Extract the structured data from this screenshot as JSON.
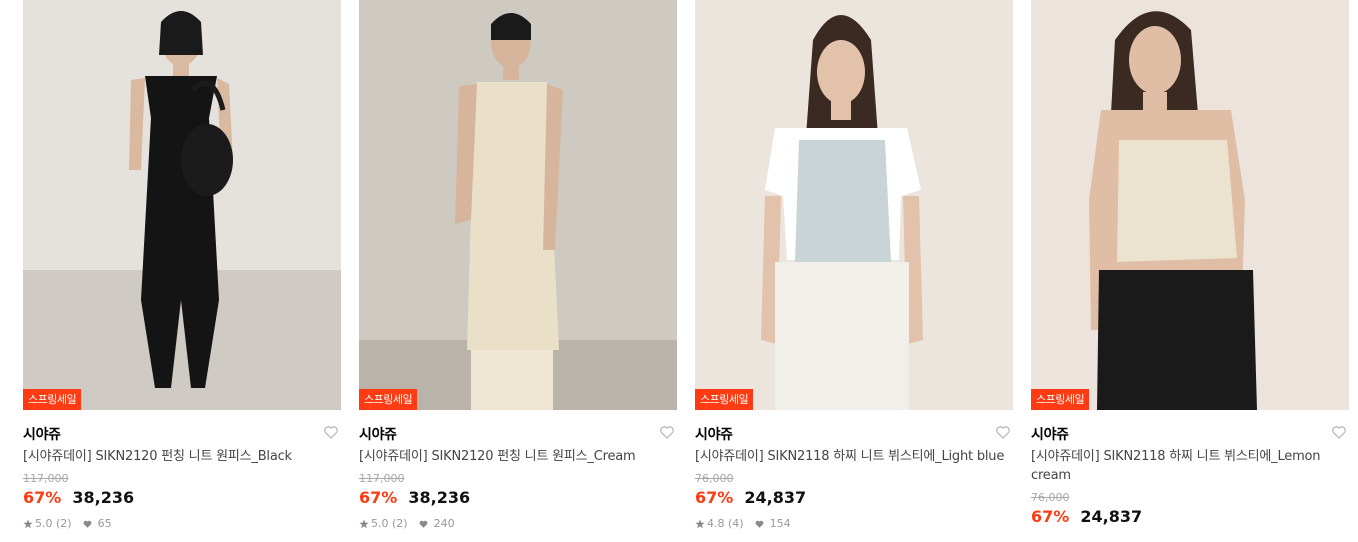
{
  "products": [
    {
      "badge": "스프링세일",
      "brand": "시야쥬",
      "title": "[시야쥬데이] SIKN2120 펀칭 니트 원피스_Black",
      "original_price": "117,000",
      "discount": "67%",
      "price": "38,236",
      "rating": "5.0 (2)",
      "likes": "65",
      "colors": {
        "bg": "#e5e2dd",
        "floor": "#cfcac3",
        "garment": "#141414",
        "pants": "#1b1b1b",
        "skin": "#d9b9a0"
      }
    },
    {
      "badge": "스프링세일",
      "brand": "시야쥬",
      "title": "[시야쥬데이] SIKN2120 펀칭 니트 원피스_Cream",
      "original_price": "117,000",
      "discount": "67%",
      "price": "38,236",
      "rating": "5.0 (2)",
      "likes": "240",
      "colors": {
        "bg": "#cfcac1",
        "floor": "#b9b3aa",
        "garment": "#eadfc7",
        "pants": "#efe6d3",
        "skin": "#d7b59c"
      }
    },
    {
      "badge": "스프링세일",
      "brand": "시야쥬",
      "title": "[시야쥬데이] SIKN2118 하찌 니트 뷔스티에_Light blue",
      "original_price": "76,000",
      "discount": "67%",
      "price": "24,837",
      "rating": "4.8 (4)",
      "likes": "154",
      "colors": {
        "bg": "#ebe5dd",
        "floor": "#e4ddd3",
        "garment": "#c9d4d6",
        "pants": "#f1efe9",
        "skin": "#e2c2aa"
      }
    },
    {
      "badge": "스프링세일",
      "brand": "시야쥬",
      "title": "[시야쥬데이] SIKN2118 하찌 니트 뷔스티에_Lemon cream",
      "original_price": "76,000",
      "discount": "67%",
      "price": "24,837",
      "rating": null,
      "likes": null,
      "colors": {
        "bg": "#ece4dc",
        "floor": "#e6ddd2",
        "garment": "#ebe3cf",
        "pants": "#1a1a1a",
        "skin": "#e0bda5"
      }
    }
  ],
  "icons": {
    "heart": "heart-outline-icon",
    "star": "star-icon",
    "like": "heart-filled-icon"
  },
  "theme": {
    "accent": "#ff3b13",
    "text": "#111111",
    "muted": "#999999"
  }
}
